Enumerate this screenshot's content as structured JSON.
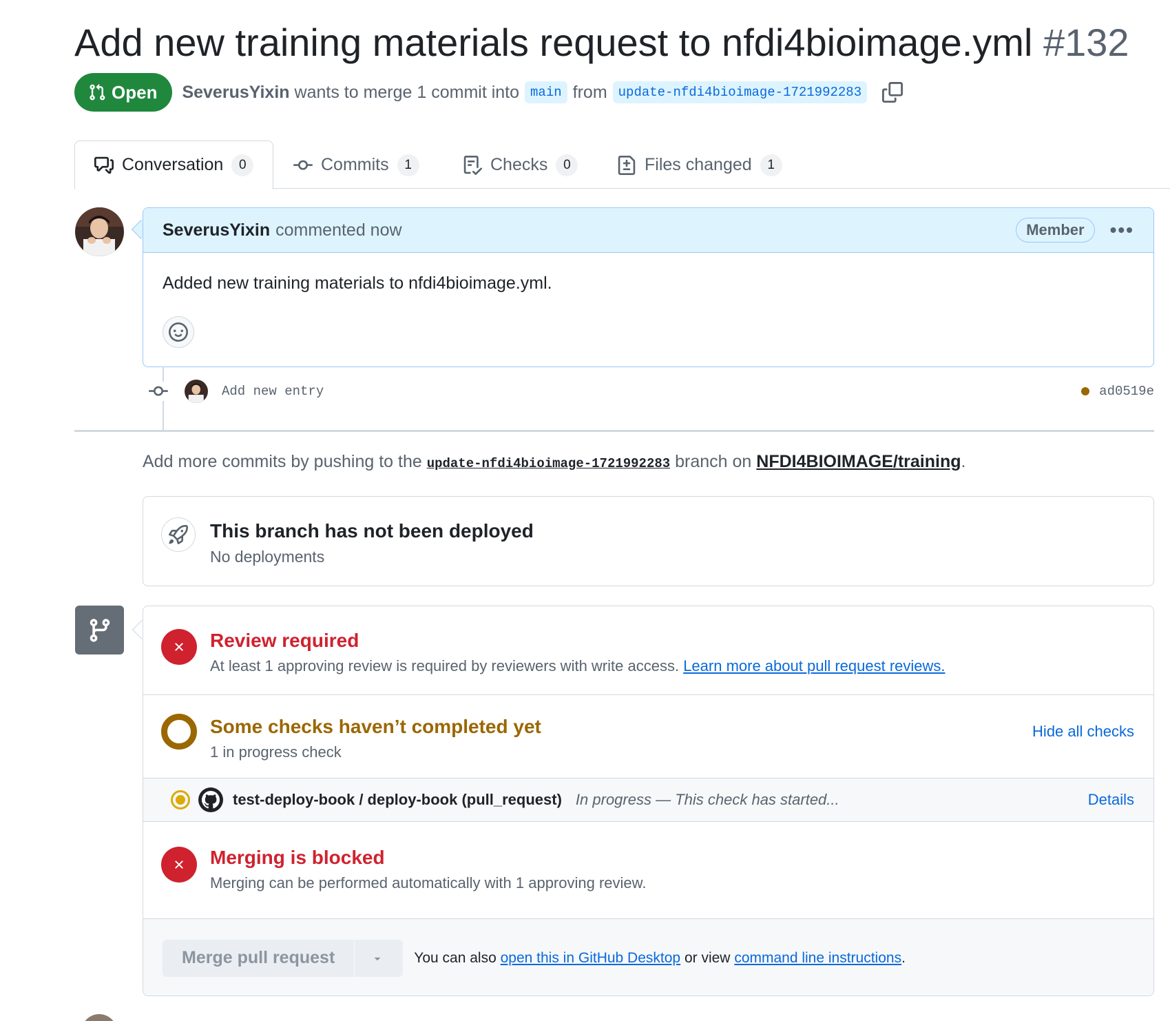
{
  "pr": {
    "title": "Add new training materials request to nfdi4bioimage.yml",
    "number": "#132",
    "state": "Open",
    "author": "SeverusYixin",
    "merge_text": "wants to merge 1 commit into",
    "base_branch": "main",
    "from_text": "from",
    "head_branch": "update-nfdi4bioimage-1721992283"
  },
  "tabs": [
    {
      "label": "Conversation",
      "count": "0"
    },
    {
      "label": "Commits",
      "count": "1"
    },
    {
      "label": "Checks",
      "count": "0"
    },
    {
      "label": "Files changed",
      "count": "1"
    }
  ],
  "comment": {
    "author": "SeverusYixin",
    "action": "commented now",
    "role": "Member",
    "body": "Added new training materials to nfdi4bioimage.yml."
  },
  "commit": {
    "message": "Add new entry",
    "sha": "ad0519e"
  },
  "push_hint": {
    "prefix": "Add more commits by pushing to the",
    "branch": "update-nfdi4bioimage-1721992283",
    "middle": "branch on",
    "repo": "NFDI4BIOIMAGE/training",
    "suffix": "."
  },
  "deploy": {
    "title": "This branch has not been deployed",
    "subtitle": "No deployments"
  },
  "review": {
    "title": "Review required",
    "text": "At least 1 approving review is required by reviewers with write access.",
    "link": "Learn more about pull request reviews."
  },
  "checks": {
    "title": "Some checks haven’t completed yet",
    "subtitle": "1 in progress check",
    "hide_label": "Hide all checks",
    "items": [
      {
        "name": "test-deploy-book / deploy-book (pull_request)",
        "status": "In progress — This check has started...",
        "details": "Details"
      }
    ]
  },
  "blocked": {
    "title": "Merging is blocked",
    "text": "Merging can be performed automatically with 1 approving review."
  },
  "merge": {
    "button_label": "Merge pull request",
    "also_prefix": "You can also",
    "desktop_link": "open this in GitHub Desktop",
    "or_text": "or view",
    "cli_link": "command line instructions",
    "suffix": "."
  },
  "colors": {
    "open_green": "#1f883d",
    "danger_red": "#cf222e",
    "attention_amber": "#9a6700",
    "accent_blue": "#0969da"
  }
}
